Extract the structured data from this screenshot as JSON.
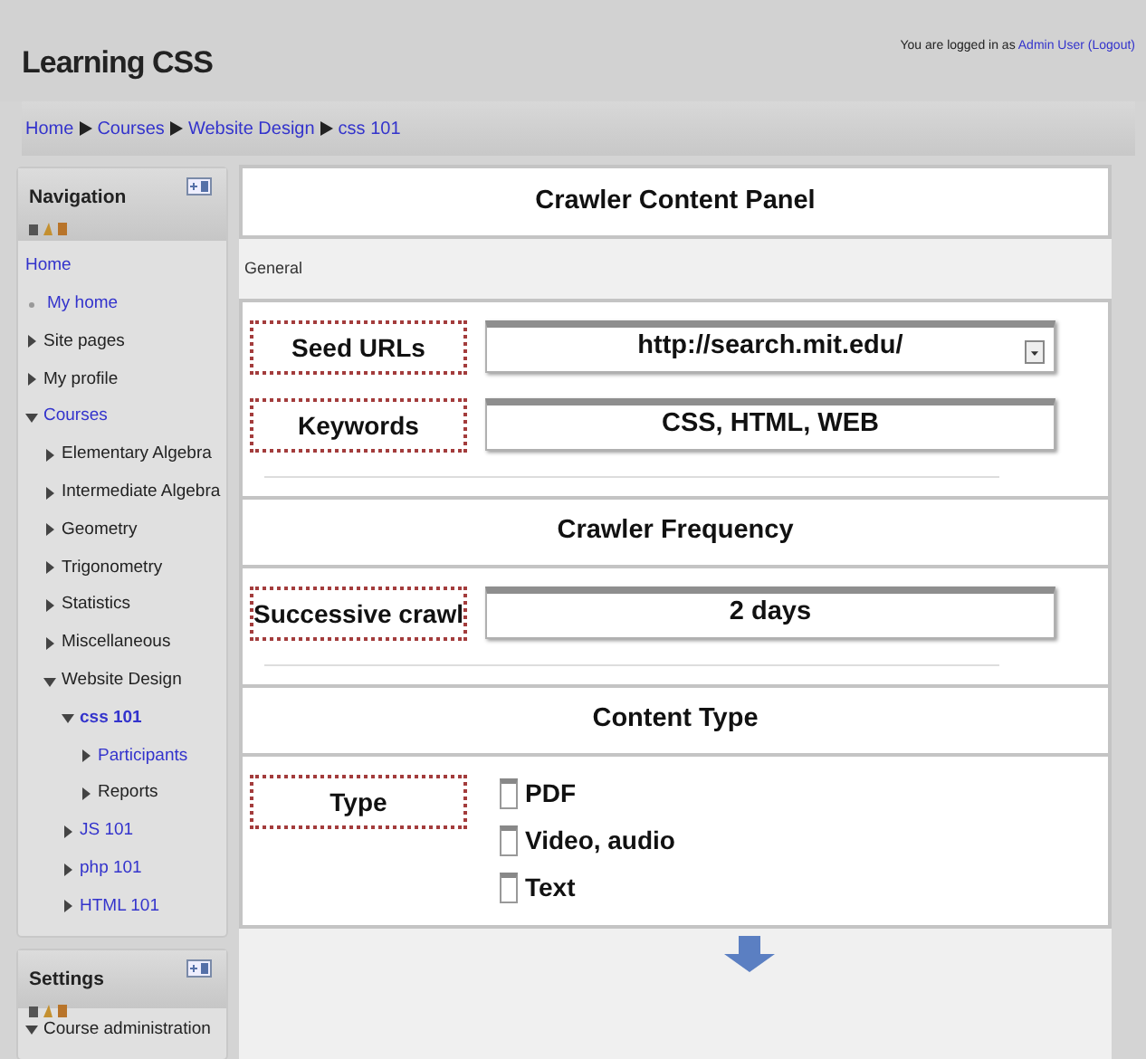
{
  "header": {
    "title": "Learning CSS",
    "login_prefix": "You are logged in as",
    "user": "Admin User",
    "logout": "(Logout)"
  },
  "breadcrumb": [
    {
      "label": "Home"
    },
    {
      "label": "Courses"
    },
    {
      "label": "Website Design"
    },
    {
      "label": "css 101"
    }
  ],
  "navigation": {
    "title": "Navigation",
    "items": [
      {
        "label": "Home",
        "kind": "plain",
        "link": true
      },
      {
        "label": "My home",
        "kind": "bullet",
        "link": true
      },
      {
        "label": "Site pages",
        "kind": "branch",
        "expanded": false,
        "link": false
      },
      {
        "label": "My profile",
        "kind": "branch",
        "expanded": false,
        "link": false
      },
      {
        "label": "Courses",
        "kind": "branch",
        "expanded": true,
        "link": true,
        "children": [
          {
            "label": "Elementary Algebra",
            "kind": "branch",
            "expanded": false,
            "link": false
          },
          {
            "label": "Intermediate Algebra",
            "kind": "branch",
            "expanded": false,
            "link": false
          },
          {
            "label": "Geometry",
            "kind": "branch",
            "expanded": false,
            "link": false
          },
          {
            "label": "Trigonometry",
            "kind": "branch",
            "expanded": false,
            "link": false
          },
          {
            "label": "Statistics",
            "kind": "branch",
            "expanded": false,
            "link": false
          },
          {
            "label": "Miscellaneous",
            "kind": "branch",
            "expanded": false,
            "link": false
          },
          {
            "label": "Website Design",
            "kind": "branch",
            "expanded": true,
            "link": false,
            "children": [
              {
                "label": "css 101",
                "kind": "branch",
                "expanded": true,
                "link": true,
                "children": [
                  {
                    "label": "Participants",
                    "kind": "branch",
                    "expanded": false,
                    "link": true
                  },
                  {
                    "label": "Reports",
                    "kind": "branch",
                    "expanded": false,
                    "link": false
                  }
                ]
              },
              {
                "label": "JS 101",
                "kind": "branch",
                "expanded": false,
                "link": true
              },
              {
                "label": "php 101",
                "kind": "branch",
                "expanded": false,
                "link": true
              },
              {
                "label": "HTML 101",
                "kind": "branch",
                "expanded": false,
                "link": true
              }
            ]
          }
        ]
      }
    ]
  },
  "settings": {
    "title": "Settings",
    "items": [
      {
        "label": "Course administration",
        "kind": "branch",
        "expanded": true,
        "link": false
      }
    ]
  },
  "panel": {
    "title": "Crawler Content Panel",
    "legend": "General",
    "sections": [
      {
        "fields": [
          {
            "label": "Seed URLs",
            "kind": "select",
            "value": "http://search.mit.edu/"
          },
          {
            "label": "Keywords",
            "kind": "text",
            "value": "CSS, HTML, WEB"
          }
        ]
      },
      {
        "title": "Crawler Frequency",
        "fields": [
          {
            "label": "Successive crawl",
            "kind": "text",
            "value": "2 days"
          }
        ]
      },
      {
        "title": "Content Type",
        "fields": [
          {
            "label": "Type",
            "kind": "checkboxes",
            "options": [
              {
                "label": "PDF",
                "checked": false
              },
              {
                "label": "Video, audio",
                "checked": false
              },
              {
                "label": "Text",
                "checked": false
              }
            ]
          }
        ]
      }
    ]
  }
}
